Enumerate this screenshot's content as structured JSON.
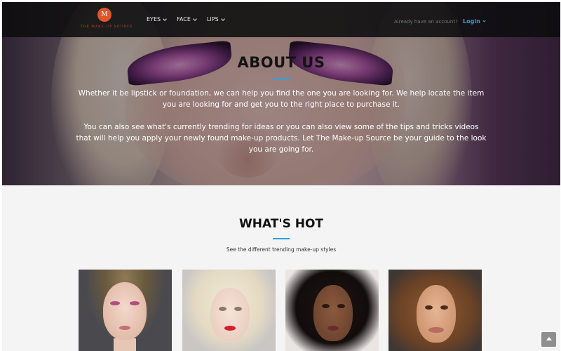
{
  "brand": {
    "logo_glyph": "M",
    "logo_text": "THE MAKE-UP SOURCE",
    "accent": "#29a3e0",
    "logo_color": "#e0562a"
  },
  "nav": {
    "items": [
      {
        "label": "EYES"
      },
      {
        "label": "FACE"
      },
      {
        "label": "LIPS"
      }
    ],
    "account_text": "Already have an account?",
    "login_label": "Login"
  },
  "about": {
    "title": "ABOUT US",
    "paragraph1": "Whether it be lipstick or foundation, we can help you find the one you are looking for. We help locate the item you are looking for and get you to the right place to purchase it.",
    "paragraph2": "You can also see what's currently trending for ideas or you can also view some of the tips and tricks videos that will help you apply your newly found make-up products. Let The Make-up Source be your guide to the look you are going for."
  },
  "whats_hot": {
    "title": "WHAT'S HOT",
    "subtitle": "See the different trending make-up styles",
    "cards": 4
  },
  "icons": [
    "caret-down-icon",
    "scroll-top-icon"
  ]
}
